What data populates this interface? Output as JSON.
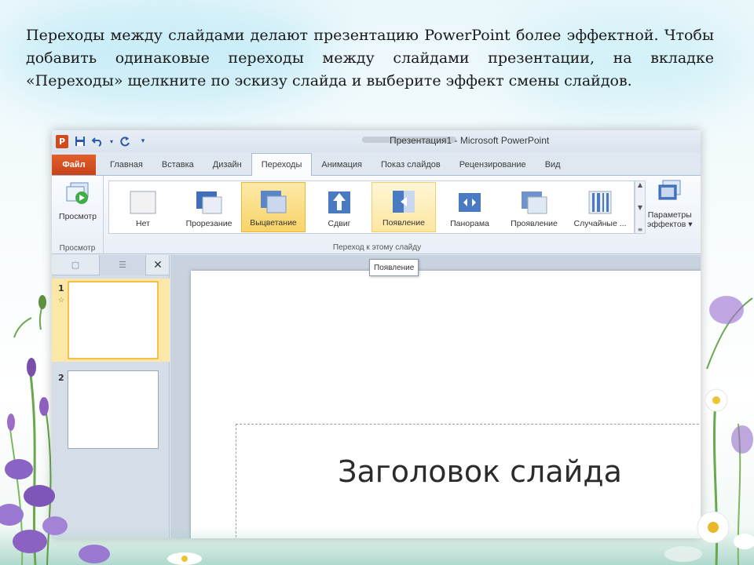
{
  "intro_text": "Переходы между слайдами делают презентацию PowerPoint более эффектной. Чтобы добавить одинаковые переходы между слайдами презентации, на вкладке «Переходы» щелкните по эскизу слайда и выберите эффект смены слайдов.",
  "window": {
    "title": "Презентация1 - Microsoft PowerPoint",
    "app_icon_letter": "P",
    "qat_icons": [
      "save-icon",
      "undo-icon",
      "redo-icon",
      "customize-icon"
    ]
  },
  "tabs": [
    {
      "label": "Файл"
    },
    {
      "label": "Главная"
    },
    {
      "label": "Вставка"
    },
    {
      "label": "Дизайн"
    },
    {
      "label": "Переходы"
    },
    {
      "label": "Анимация"
    },
    {
      "label": "Показ слайдов"
    },
    {
      "label": "Рецензирование"
    },
    {
      "label": "Вид"
    }
  ],
  "active_tab": "Переходы",
  "ribbon": {
    "preview_button": "Просмотр",
    "preview_group": "Просмотр",
    "transitions_group": "Переход к этому слайду",
    "transitions": [
      {
        "label": "Нет"
      },
      {
        "label": "Прорезание"
      },
      {
        "label": "Выцветание"
      },
      {
        "label": "Сдвиг"
      },
      {
        "label": "Появление"
      },
      {
        "label": "Панорама"
      },
      {
        "label": "Проявление"
      },
      {
        "label": "Случайные ..."
      }
    ],
    "effect_params_line1": "Параметры",
    "effect_params_line2": "эффектов ▾"
  },
  "tooltip": "Появление",
  "slides_pane": {
    "slides": [
      {
        "number": "1"
      },
      {
        "number": "2"
      }
    ],
    "close_label": "✕"
  },
  "slide": {
    "title_placeholder": "Заголовок слайда"
  },
  "colors": {
    "file_tab": "#d04a1b",
    "selected_item": "#f9d367",
    "ribbon_bg": "#f4f7fb"
  }
}
